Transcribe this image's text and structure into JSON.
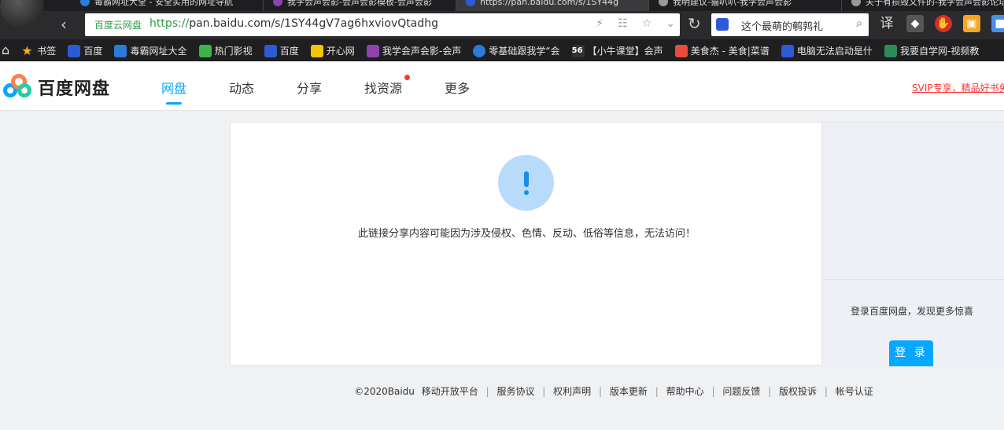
{
  "browser": {
    "tabs": [
      {
        "title": "毒霸网址大全 - 安全实用的网址导航"
      },
      {
        "title": "我学会声会影-会声会影模板-会声会影"
      },
      {
        "title": "https://pan.baidu.com/s/1SY44g"
      },
      {
        "title": "我明建议-猫叭叭-我学会声会影"
      },
      {
        "title": "关于有损毁文件的-我学会声会影论坛"
      }
    ],
    "address": {
      "site_tag": "百度云网盘",
      "protocol": "https://",
      "host_path": "pan.baidu.com/s/1SY44gV7ag6hxviovQtadhg"
    },
    "search_text": "这个最萌的鹌鹑礼",
    "translate_label": "译",
    "bookmarks": [
      {
        "label": "书签",
        "color": "#f5b400"
      },
      {
        "label": "百度",
        "color": "#2d5bd6"
      },
      {
        "label": "毒霸网址大全",
        "color": "#2b7bd8"
      },
      {
        "label": "热门影视",
        "color": "#3bb54a"
      },
      {
        "label": "百度",
        "color": "#2d5bd6"
      },
      {
        "label": "开心网",
        "color": "#f5c400"
      },
      {
        "label": "我学会声会影-会声",
        "color": "#8e44ad"
      },
      {
        "label": "零基础跟我学“会",
        "color": "#2b7bd8"
      },
      {
        "label": "【小牛课堂】会声",
        "color": "#333333"
      },
      {
        "label": "美食杰 - 美食|菜谱",
        "color": "#e74c3c"
      },
      {
        "label": "电脑无法启动是什",
        "color": "#2d5bd6"
      },
      {
        "label": "我要自学网-视频教",
        "color": "#2e8b57"
      }
    ]
  },
  "header": {
    "logo_text": "百度网盘",
    "nav": [
      "网盘",
      "动态",
      "分享",
      "找资源",
      "更多"
    ],
    "svip_text": "SVIP专享，精品好书免费读"
  },
  "main": {
    "error_message": "此链接分享内容可能因为涉及侵权、色情、反动、低俗等信息，无法访问！",
    "side_text": "登录百度网盘，发现更多惊喜",
    "login_label": "登 录"
  },
  "footer": {
    "copyright": "©2020Baidu",
    "links": [
      "移动开放平台",
      "服务协议",
      "权利声明",
      "版本更新",
      "帮助中心",
      "问题反馈",
      "版权投诉",
      "帐号认证"
    ]
  },
  "colors": {
    "accent": "#06a7ff",
    "svip": "#ff3333"
  }
}
